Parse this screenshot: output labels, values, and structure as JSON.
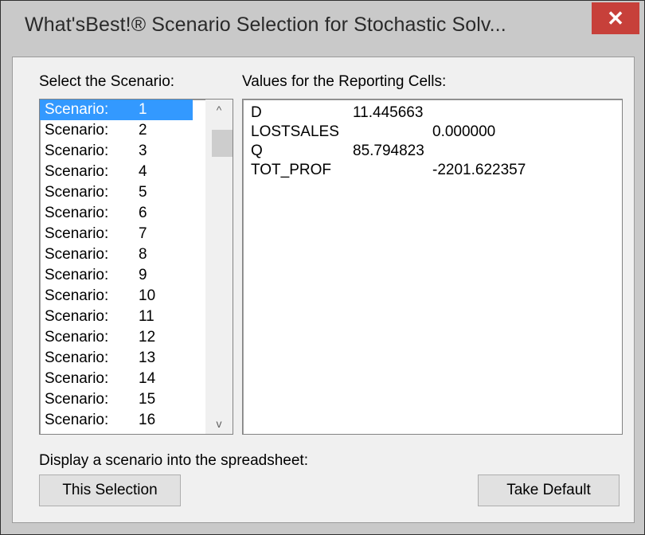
{
  "window": {
    "title": "What'sBest!® Scenario Selection for Stochastic Solv...",
    "close_label": "✕"
  },
  "left_label": "Select the Scenario:",
  "right_label": "Values for the Reporting Cells:",
  "scenarios": [
    {
      "name": "Scenario:",
      "num": "1"
    },
    {
      "name": "Scenario:",
      "num": "2"
    },
    {
      "name": "Scenario:",
      "num": "3"
    },
    {
      "name": "Scenario:",
      "num": "4"
    },
    {
      "name": "Scenario:",
      "num": "5"
    },
    {
      "name": "Scenario:",
      "num": "6"
    },
    {
      "name": "Scenario:",
      "num": "7"
    },
    {
      "name": "Scenario:",
      "num": "8"
    },
    {
      "name": "Scenario:",
      "num": "9"
    },
    {
      "name": "Scenario:",
      "num": "10"
    },
    {
      "name": "Scenario:",
      "num": "11"
    },
    {
      "name": "Scenario:",
      "num": "12"
    },
    {
      "name": "Scenario:",
      "num": "13"
    },
    {
      "name": "Scenario:",
      "num": "14"
    },
    {
      "name": "Scenario:",
      "num": "15"
    },
    {
      "name": "Scenario:",
      "num": "16"
    }
  ],
  "selected_scenario": "1",
  "values": [
    {
      "name": "D",
      "value": "11.445663"
    },
    {
      "name": "LOSTSALES",
      "value": "0.000000"
    },
    {
      "name": "Q",
      "value": "85.794823"
    },
    {
      "name": "TOT_PROF",
      "value": "-2201.622357"
    }
  ],
  "display_label": "Display a scenario into the spreadsheet:",
  "buttons": {
    "this_selection": "This Selection",
    "take_default": "Take Default"
  },
  "colors": {
    "selection": "#3399ff",
    "close": "#c7403a",
    "window_frame": "#c9c9c9"
  }
}
